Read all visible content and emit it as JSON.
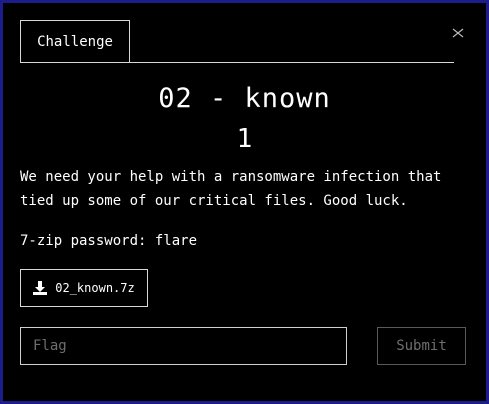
{
  "tabs": [
    {
      "label": "Challenge",
      "active": true
    }
  ],
  "close_icon": "close-icon",
  "challenge": {
    "name": "02 - known",
    "value": "1",
    "description": [
      "We need your help with a ransomware infection that",
      "tied up some of our critical files. Good luck."
    ],
    "password_text": "7-zip password: flare",
    "file": {
      "icon": "download-icon",
      "name": "02_known.7z"
    }
  },
  "form": {
    "flag_placeholder": "Flag",
    "flag_value": "",
    "submit_label": "Submit"
  },
  "colors": {
    "page_background": "#1c1c8c",
    "modal_background": "#000000",
    "text": "#ffffff",
    "border": "#d8d8d8",
    "muted": "#6e6e6e"
  }
}
